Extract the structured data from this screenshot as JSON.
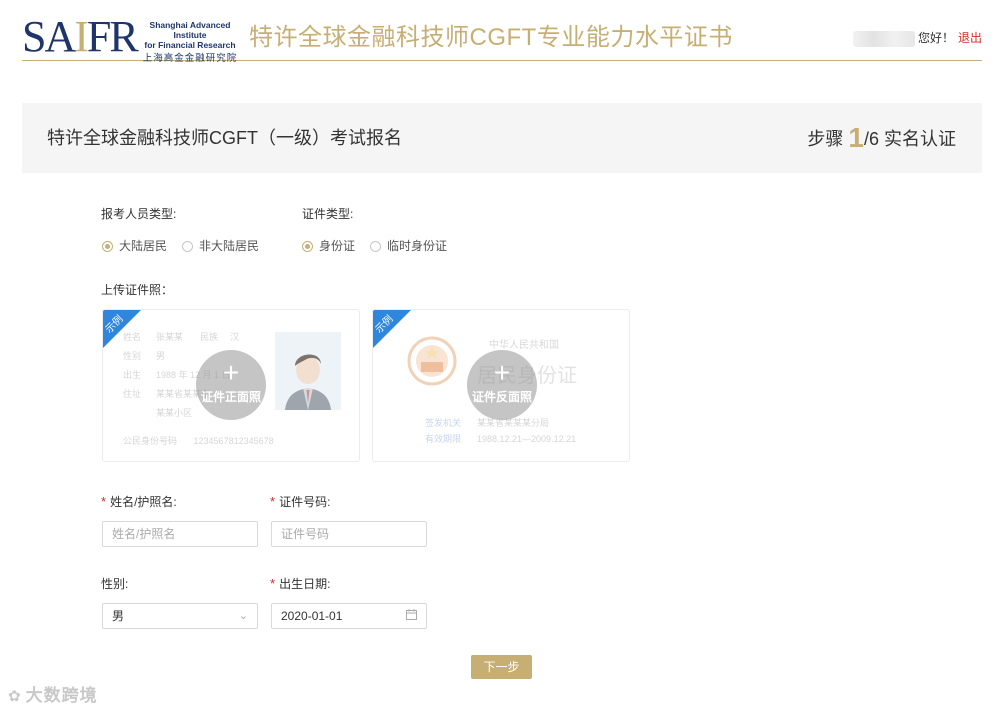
{
  "header": {
    "logo": {
      "mark": "SAIFR",
      "name_en_line1": "Shanghai Advanced Institute",
      "name_en_line2": "for Financial Research",
      "name_cn": "上海高金金融研究院"
    },
    "site_title": "特许全球金融科技师CGFT专业能力水平证书",
    "greeting": "您好！",
    "logout": "退出"
  },
  "title_band": {
    "title": "特许全球金融科技师CGFT（一级）考试报名",
    "step_label": "步骤",
    "step_current": "1",
    "step_total": "/6",
    "step_name": "实名认证"
  },
  "form": {
    "applicant_type": {
      "label": "报考人员类型:",
      "options": [
        "大陆居民",
        "非大陆居民"
      ],
      "selected": "大陆居民"
    },
    "id_type": {
      "label": "证件类型:",
      "options": [
        "身份证",
        "临时身份证"
      ],
      "selected": "身份证"
    },
    "upload_label": "上传证件照：",
    "upload_cards": [
      {
        "ribbon": "示例",
        "action": "证件正面照",
        "sample_rows": [
          {
            "k": "姓名",
            "v": "张某某",
            "k2": "民族",
            "v2": "汉"
          },
          {
            "k": "性别",
            "v": "男",
            "k2": "",
            "v2": ""
          },
          {
            "k": "出生",
            "v": "1988 年 12 月 1 日",
            "k2": "",
            "v2": ""
          },
          {
            "k": "住址",
            "v": "某某省某某市",
            "k2": "",
            "v2": ""
          },
          {
            "k": "",
            "v": "某某小区",
            "k2": "",
            "v2": ""
          }
        ],
        "id_label": "公民身份号码",
        "id_number": "123456781234567​8"
      },
      {
        "ribbon": "示例",
        "action": "证件反面照",
        "header": "中华人民共和国",
        "big_title": "居民身份证",
        "sample_rows": [
          {
            "k": "签发机关",
            "v": "某某省某某某分局"
          },
          {
            "k": "有效期限",
            "v": "1988.12.21—2009.12.21"
          }
        ]
      }
    ],
    "name_field": {
      "label": "姓名/护照名:",
      "placeholder": "姓名/护照名",
      "required": "*"
    },
    "id_number_field": {
      "label": "证件号码:",
      "placeholder": "证件号码",
      "required": "*"
    },
    "gender_field": {
      "label": "性别:",
      "value": "男"
    },
    "birth_field": {
      "label": "出生日期:",
      "value": "2020-01-01",
      "required": "*"
    },
    "next_button": "下一步"
  },
  "watermark": "大数跨境",
  "colors": {
    "gold": "#c7ae73",
    "navy": "#1f3569",
    "ribbon_blue": "#2f86dd",
    "required_red": "#d12b2b"
  }
}
